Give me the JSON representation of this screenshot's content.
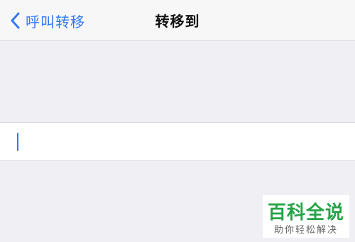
{
  "nav": {
    "back_label": "呼叫转移",
    "title": "转移到"
  },
  "input": {
    "value": "",
    "placeholder": ""
  },
  "watermark": {
    "title": "百科全说",
    "subtitle": "助你轻松解决"
  },
  "icons": {
    "back": "chevron-left-icon"
  },
  "colors": {
    "accent": "#3478f6",
    "background": "#efeff4",
    "nav_background": "#f7f7f7",
    "watermark_green": "#27a348"
  }
}
